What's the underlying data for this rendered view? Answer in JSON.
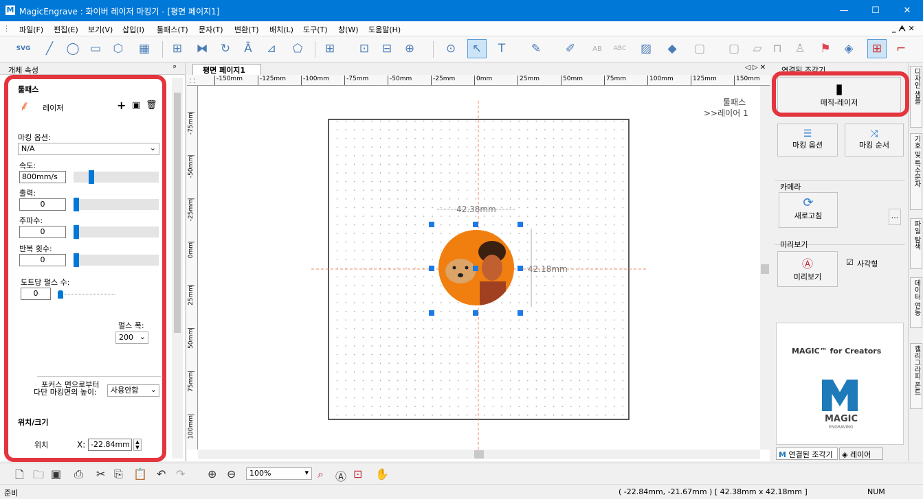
{
  "window": {
    "app_logo": "M",
    "title": "MagicEngrave : 화이버 레이저 마킹기 - [평면  페이지1]",
    "minimize": "—",
    "maximize": "☐",
    "close": "✕"
  },
  "menu": [
    "파일(F)",
    "편집(E)",
    "보기(V)",
    "삽입(I)",
    "툴패스(T)",
    "문자(T)",
    "변환(T)",
    "배치(L)",
    "도구(T)",
    "창(W)",
    "도움말(H)"
  ],
  "menu_right": "_ ᗅ ✕",
  "toolbar_icons": [
    "svg-import-icon",
    "line-icon",
    "circle-icon",
    "rectangle-icon",
    "polygon-icon",
    "qrcode-icon",
    "table-icon",
    "mirror-icon",
    "rotate-icon",
    "text-a-icon",
    "shear-icon",
    "shape-icon",
    "grid-icon",
    "align-icon",
    "align-center-icon",
    "distribute-icon",
    "group-icon",
    "select-arrow-icon",
    "text-tool-icon",
    "pen-icon",
    "brush-icon",
    "ab-text-icon",
    "abc-text-icon",
    "image-icon",
    "fill-icon",
    "frame-icon",
    "frame2-icon",
    "frame3-icon",
    "stamp-icon",
    "person-icon",
    "flag-icon",
    "layers-icon",
    "crosshair-icon",
    "corner-icon"
  ],
  "left_panel": {
    "header": "개체 속성",
    "pin": "ᵖ",
    "toolpath_title": "툴패스",
    "laser_label": "레이저",
    "marking_option_label": "마킹 옵션:",
    "marking_option_value": "N/A",
    "speed_label": "속도:",
    "speed_value": "800mm/s",
    "power_label": "출력:",
    "power_value": "0",
    "freq_label": "주파수:",
    "freq_value": "0",
    "repeat_label": "반복 횟수:",
    "repeat_value": "0",
    "pulse_per_dot_label": "도트당 펄스 수:",
    "pulse_per_dot_value": "0",
    "pulse_width_label": "펄스 폭:",
    "pulse_width_value": "200",
    "focus_label_1": "포커스 면으로부터",
    "focus_label_2": "다단 마킹면의 높이:",
    "focus_value": "사용안함",
    "pos_size_title": "위치/크기",
    "position_label": "위치",
    "x_label": "X:",
    "x_value": "-22.84mm"
  },
  "canvas": {
    "tab_label": "평면  페이지1",
    "ruler_labels": [
      "-150mm",
      "-125mm",
      "-100mm",
      "-75mm",
      "-50mm",
      "-25mm",
      "0mm",
      "25mm",
      "50mm",
      "75mm",
      "100mm",
      "125mm",
      "150mm"
    ],
    "vruler_labels": [
      "-75mm",
      "-50mm",
      "-25mm",
      "0mm",
      "25mm",
      "50mm",
      "75mm",
      "100mm"
    ],
    "toolpath_label": "툴패스",
    "layer_label": ">>레이어 1",
    "width_dim": "42.38mm",
    "height_dim": "42.18mm",
    "nav": "◁ ▷ ✕"
  },
  "right_panel": {
    "header": "연결된 조각기",
    "device_label": "매직-레이저",
    "marking_option_btn": "마킹 옵션",
    "marking_order_btn": "마킹 순서",
    "camera_label": "카메라",
    "refresh_btn": "새로고침",
    "more_btn": "...",
    "preview_label": "미리보기",
    "preview_btn": "미리보기",
    "rect_checkbox": "사각형",
    "ad_title": "MAGIC™ for Creators",
    "ad_logo": "MAGIC",
    "ad_sub": "ENGRAVING",
    "tab_connected": "연결된 조각기",
    "tab_layer": "레이어"
  },
  "vertical_tabs": [
    "디자인 샘플",
    "기호 및 특수문자",
    "파일 탐색",
    "데이터 연동",
    "캘리그라피 폰트"
  ],
  "bottom_toolbar": {
    "zoom_value": "100%"
  },
  "status": {
    "left": "준비",
    "coords": "( -22.84mm, -21.67mm )  [ 42.38mm x 42.18mm ]",
    "num": "NUM"
  },
  "colors": {
    "titlebar": "#0078d7",
    "highlight": "#e4343e",
    "accent": "#0078d7",
    "guide": "#f08a6a",
    "image_fill": "#f07f10"
  }
}
